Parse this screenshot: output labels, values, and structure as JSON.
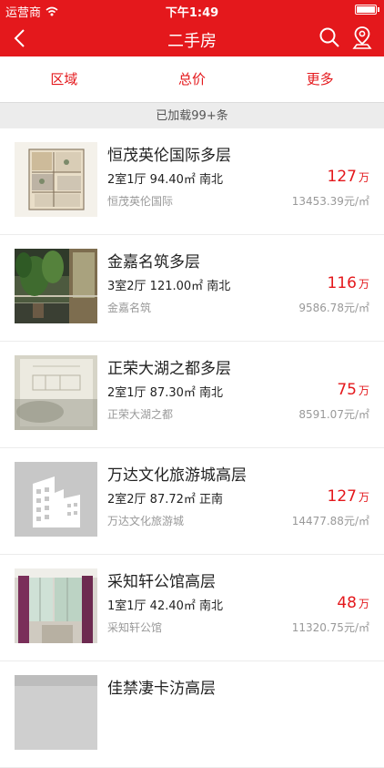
{
  "status_bar": {
    "carrier": "运营商",
    "time": "下午1:49"
  },
  "nav": {
    "title": "二手房"
  },
  "filters": [
    "区域",
    "总价",
    "更多"
  ],
  "loaded_text": "已加载99+条",
  "colors": {
    "brand_red": "#e4181c",
    "muted_gray": "#999999"
  },
  "listings": [
    {
      "title": "恒茂英伦国际多层",
      "layout": "2室1厅 94.40㎡ 南北",
      "estate": "恒茂英伦国际",
      "price": "127",
      "price_unit": "万",
      "unit_price": "13453.39元/㎡"
    },
    {
      "title": "金嘉名筑多层",
      "layout": "3室2厅 121.00㎡ 南北",
      "estate": "金嘉名筑",
      "price": "116",
      "price_unit": "万",
      "unit_price": "9586.78元/㎡"
    },
    {
      "title": "正荣大湖之都多层",
      "layout": "2室1厅 87.30㎡ 南北",
      "estate": "正荣大湖之都",
      "price": "75",
      "price_unit": "万",
      "unit_price": "8591.07元/㎡"
    },
    {
      "title": "万达文化旅游城高层",
      "layout": "2室2厅 87.72㎡ 正南",
      "estate": "万达文化旅游城",
      "price": "127",
      "price_unit": "万",
      "unit_price": "14477.88元/㎡"
    },
    {
      "title": "采知轩公馆高层",
      "layout": "1室1厅 42.40㎡ 南北",
      "estate": "采知轩公馆",
      "price": "48",
      "price_unit": "万",
      "unit_price": "11320.75元/㎡"
    },
    {
      "title": "佳禁凄卡汸高层",
      "layout": "",
      "estate": "",
      "price": "",
      "price_unit": "",
      "unit_price": ""
    }
  ]
}
